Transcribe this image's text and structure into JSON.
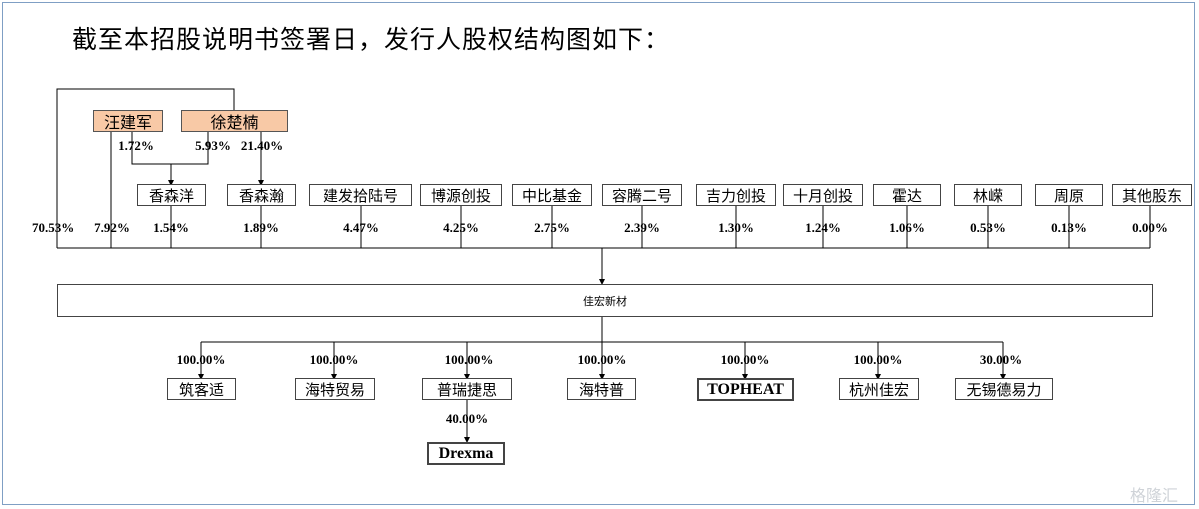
{
  "title": "截至本招股说明书签署日，发行人股权结构图如下：",
  "persons": [
    {
      "id": "wang",
      "label": "汪建军"
    },
    {
      "id": "xu",
      "label": "徐楚楠"
    }
  ],
  "person_links": {
    "wang_to_xiangsenyang": "1.72%",
    "xu_to_xiangsenyang": "5.93%",
    "xu_to_xiangsenhan": "21.40%"
  },
  "shareholders": [
    {
      "id": "xu-direct",
      "label": "",
      "pct": "70.53%"
    },
    {
      "id": "wang-direct",
      "label": "",
      "pct": "7.92%"
    },
    {
      "id": "xiangsenyang",
      "label": "香森洋",
      "pct": "1.54%"
    },
    {
      "id": "xiangsenhan",
      "label": "香森瀚",
      "pct": "1.89%"
    },
    {
      "id": "jianfa",
      "label": "建发拾陆号",
      "pct": "4.47%"
    },
    {
      "id": "boyuan",
      "label": "博源创投",
      "pct": "4.25%"
    },
    {
      "id": "zhongbi",
      "label": "中比基金",
      "pct": "2.75%"
    },
    {
      "id": "rongteng",
      "label": "容腾二号",
      "pct": "2.39%"
    },
    {
      "id": "jili",
      "label": "吉力创投",
      "pct": "1.30%"
    },
    {
      "id": "shiyue",
      "label": "十月创投",
      "pct": "1.24%"
    },
    {
      "id": "huoda",
      "label": "霍达",
      "pct": "1.06%"
    },
    {
      "id": "linkun",
      "label": "林嵘",
      "pct": "0.53%"
    },
    {
      "id": "zhouyuan",
      "label": "周原",
      "pct": "0.13%"
    },
    {
      "id": "others",
      "label": "其他股东",
      "pct": "0.00%"
    }
  ],
  "company": "佳宏新材",
  "subsidiaries": [
    {
      "id": "zhukeshi",
      "label": "筑客适",
      "pct": "100.00%"
    },
    {
      "id": "haitemaoyi",
      "label": "海特贸易",
      "pct": "100.00%"
    },
    {
      "id": "puruijiesi",
      "label": "普瑞捷思",
      "pct": "100.00%"
    },
    {
      "id": "haitepu",
      "label": "海特普",
      "pct": "100.00%"
    },
    {
      "id": "topheat",
      "label": "TOPHEAT",
      "pct": "100.00%"
    },
    {
      "id": "hangzhou",
      "label": "杭州佳宏",
      "pct": "100.00%"
    },
    {
      "id": "wuxi",
      "label": "无锡德易力",
      "pct": "30.00%"
    }
  ],
  "sub_subsidiary": {
    "label": "Drexma",
    "pct": "40.00%"
  },
  "watermark": "格隆汇"
}
